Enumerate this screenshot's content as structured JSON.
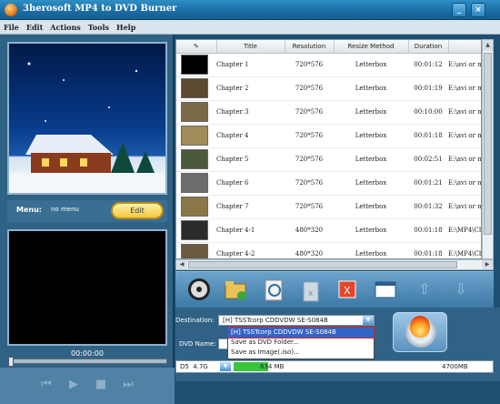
{
  "window": {
    "title": "3herosoft MP4 to DVD Burner",
    "min": "_",
    "close": "×"
  },
  "menu": [
    "File",
    "Edit",
    "Actions",
    "Tools",
    "Help"
  ],
  "preview": {
    "menu_label": "Menu:",
    "menu_value": "no menu",
    "edit_label": "Edit"
  },
  "player": {
    "timecode": "00:00:00",
    "buttons": [
      "previous-icon",
      "play-icon",
      "stop-icon",
      "next-icon"
    ]
  },
  "table": {
    "columns": [
      "",
      "Title",
      "Resolution",
      "Resize Method",
      "Duration",
      ""
    ],
    "rows": [
      {
        "title": "Chapter 1",
        "resolution": "720*576",
        "resize": "Letterbox",
        "duration": "00:01:12",
        "path": "E:\\avi or m"
      },
      {
        "title": "Chapter 2",
        "resolution": "720*576",
        "resize": "Letterbox",
        "duration": "00:01:19",
        "path": "E:\\avi or m"
      },
      {
        "title": "Chapter 3",
        "resolution": "720*576",
        "resize": "Letterbox",
        "duration": "00:10:00",
        "path": "E:\\avi or m"
      },
      {
        "title": "Chapter 4",
        "resolution": "720*576",
        "resize": "Letterbox",
        "duration": "00:01:18",
        "path": "E:\\avi or m"
      },
      {
        "title": "Chapter 5",
        "resolution": "720*576",
        "resize": "Letterbox",
        "duration": "00:02:51",
        "path": "E:\\avi or m"
      },
      {
        "title": "Chapter 6",
        "resolution": "720*576",
        "resize": "Letterbox",
        "duration": "00:01:21",
        "path": "E:\\avi or m"
      },
      {
        "title": "Chapter 7",
        "resolution": "720*576",
        "resize": "Letterbox",
        "duration": "00:01:32",
        "path": "E:\\avi or m"
      },
      {
        "title": "Chapter 4-1",
        "resolution": "480*320",
        "resize": "Letterbox",
        "duration": "00:01:18",
        "path": "E:\\MP4\\Chap"
      },
      {
        "title": "Chapter 4-2",
        "resolution": "480*320",
        "resize": "Letterbox",
        "duration": "00:01:18",
        "path": "E:\\MP4\\Chap"
      }
    ]
  },
  "toolbar": [
    "add-video-icon",
    "add-folder-icon",
    "edit-settings-icon",
    "delete-icon",
    "clear-all-icon",
    "properties-icon",
    "move-up-icon",
    "move-down-icon"
  ],
  "destination": {
    "label": "Destination:",
    "value": "[H] TSSTcorp CDDVDW SE-S084B",
    "options": [
      "[H] TSSTcorp CDDVDW SE-S084B",
      "Save as DVD Folder...",
      "Save as Image(.iso)..."
    ]
  },
  "dvdname": {
    "label": "DVD Name:"
  },
  "disc": {
    "type": "D5",
    "size": "4.7G",
    "used": "634 MB",
    "total": "4700MB",
    "used_fraction": 0.135
  }
}
